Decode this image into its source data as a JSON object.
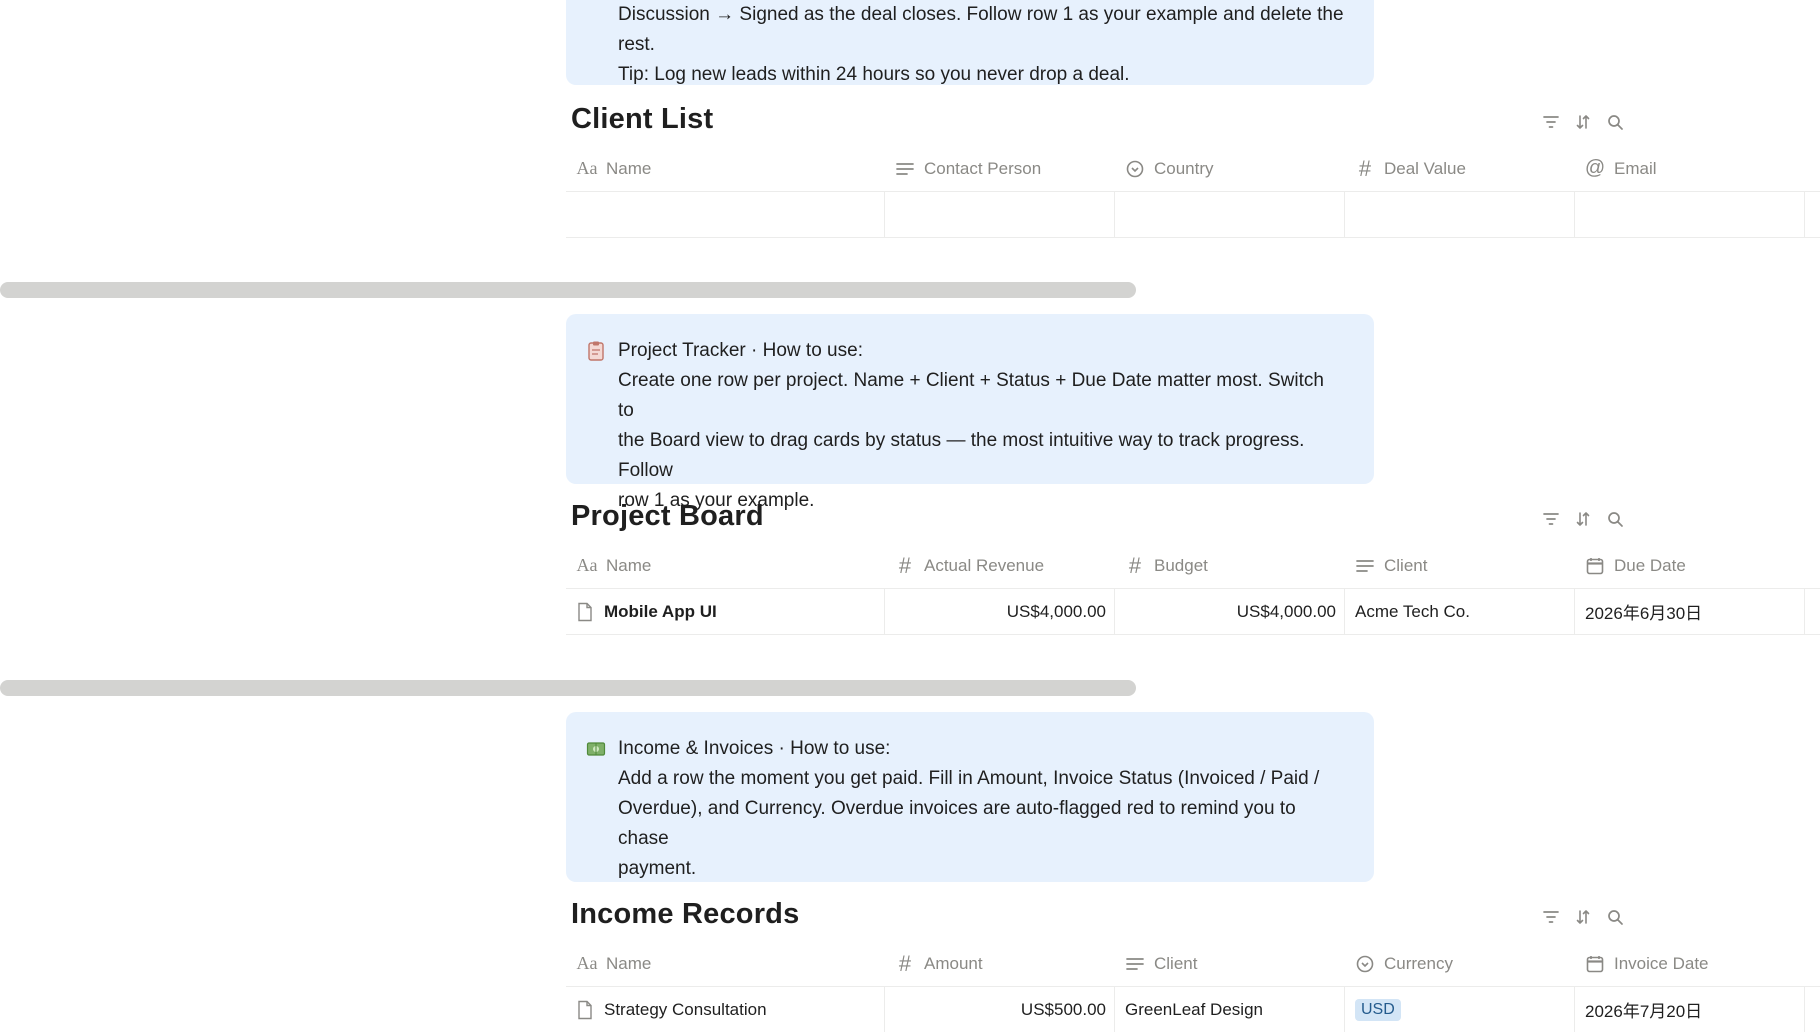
{
  "callout_top": {
    "lines": [
      "Discussion → Signed as the deal closes. Follow row 1 as your example and delete the rest.",
      "Tip: Log new leads within 24 hours so you never drop a deal."
    ]
  },
  "client_list": {
    "title": "Client List",
    "columns": [
      {
        "label": "Name",
        "icon": "text-type-icon"
      },
      {
        "label": "Contact Person",
        "icon": "text-lines-icon"
      },
      {
        "label": "Country",
        "icon": "select-icon"
      },
      {
        "label": "Deal Value",
        "icon": "number-icon"
      },
      {
        "label": "Email",
        "icon": "at-icon"
      }
    ]
  },
  "project_callout": {
    "icon": "clipboard-icon",
    "title": "Project Tracker · How to use:",
    "lines": [
      "Create one row per project. Name + Client + Status + Due Date matter most. Switch to",
      "the Board view to drag cards by status — the most intuitive way to track progress. Follow",
      "row 1 as your example."
    ]
  },
  "project_board": {
    "title": "Project Board",
    "columns": [
      {
        "label": "Name",
        "icon": "text-type-icon"
      },
      {
        "label": "Actual Revenue",
        "icon": "number-icon"
      },
      {
        "label": "Budget",
        "icon": "number-icon"
      },
      {
        "label": "Client",
        "icon": "text-lines-icon"
      },
      {
        "label": "Due Date",
        "icon": "calendar-icon"
      }
    ],
    "rows": [
      {
        "name": "Mobile App UI",
        "actual_revenue": "US$4,000.00",
        "budget": "US$4,000.00",
        "client": "Acme Tech Co.",
        "due_date": "2026年6月30日"
      }
    ]
  },
  "income_callout": {
    "icon": "money-icon",
    "title": "Income & Invoices · How to use:",
    "lines": [
      "Add a row the moment you get paid. Fill in Amount, Invoice Status (Invoiced / Paid /",
      "Overdue), and Currency. Overdue invoices are auto-flagged red to remind you to chase",
      "payment."
    ]
  },
  "income_records": {
    "title": "Income Records",
    "columns": [
      {
        "label": "Name",
        "icon": "text-type-icon"
      },
      {
        "label": "Amount",
        "icon": "number-icon"
      },
      {
        "label": "Client",
        "icon": "text-lines-icon"
      },
      {
        "label": "Currency",
        "icon": "select-icon"
      },
      {
        "label": "Invoice Date",
        "icon": "calendar-icon"
      }
    ],
    "rows": [
      {
        "name": "Strategy Consultation",
        "amount": "US$500.00",
        "client": "GreenLeaf Design",
        "currency": "USD",
        "invoice_date": "2026年7月20日"
      }
    ]
  },
  "colors": {
    "callout_bg": "#e7f1fd",
    "tag_bg": "#d3e5f6",
    "scrollbar": "#d3d3d1"
  }
}
